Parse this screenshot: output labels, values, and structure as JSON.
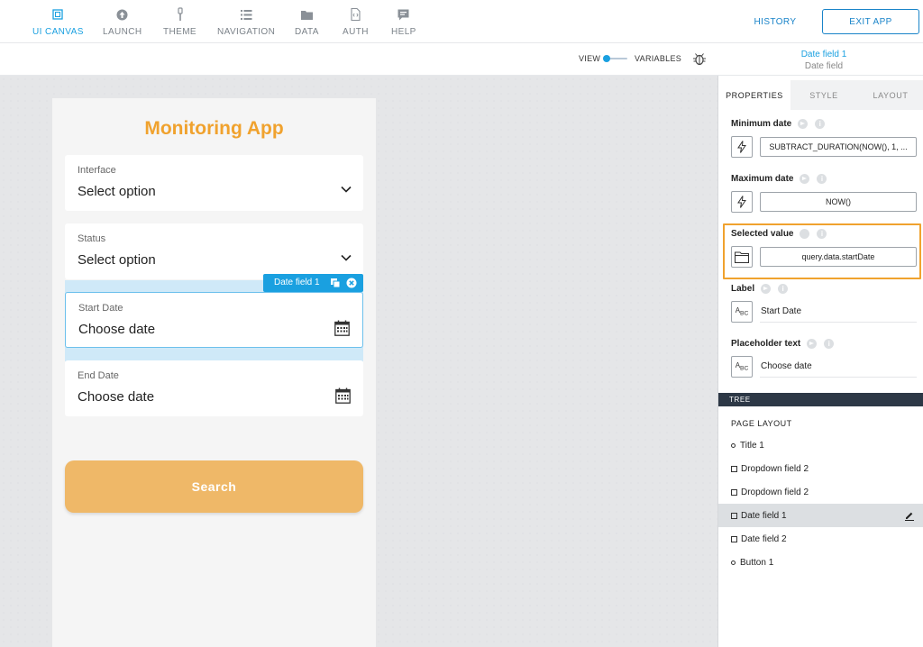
{
  "topnav": {
    "items": [
      {
        "label": "UI CANVAS",
        "icon": "canvas-icon",
        "active": true
      },
      {
        "label": "LAUNCH",
        "icon": "launch-icon"
      },
      {
        "label": "THEME",
        "icon": "theme-icon"
      },
      {
        "label": "NAVIGATION",
        "icon": "navigation-icon"
      },
      {
        "label": "DATA",
        "icon": "folder-icon"
      },
      {
        "label": "AUTH",
        "icon": "auth-icon"
      },
      {
        "label": "HELP",
        "icon": "help-icon"
      }
    ],
    "history_label": "HISTORY",
    "exit_label": "EXIT APP"
  },
  "subbar": {
    "view_label": "VIEW",
    "variables_label": "VARIABLES",
    "selected_title": "Date field 1",
    "selected_subtitle": "Date field"
  },
  "app": {
    "title": "Monitoring App",
    "fields": [
      {
        "label": "Interface",
        "value": "Select option",
        "kind": "dropdown"
      },
      {
        "label": "Status",
        "value": "Select option",
        "kind": "dropdown"
      },
      {
        "label": "Start Date",
        "value": "Choose date",
        "kind": "date"
      },
      {
        "label": "End Date",
        "value": "Choose date",
        "kind": "date"
      }
    ],
    "selection_tag": "Date field 1",
    "search_label": "Search"
  },
  "panel": {
    "tabs": [
      "PROPERTIES",
      "STYLE",
      "LAYOUT"
    ],
    "properties": {
      "min_date": {
        "title": "Minimum date",
        "value": "SUBTRACT_DURATION(NOW(), 1, ..."
      },
      "max_date": {
        "title": "Maximum date",
        "value": "NOW()"
      },
      "selected_value": {
        "title": "Selected value",
        "value": "query.data.startDate"
      },
      "label": {
        "title": "Label",
        "value": "Start Date"
      },
      "placeholder": {
        "title": "Placeholder text",
        "value": "Choose date"
      }
    },
    "tree": {
      "bar_label": "TREE",
      "heading": "PAGE LAYOUT",
      "items": [
        "Title 1",
        "Dropdown field 2",
        "Dropdown field 2",
        "Date field 1",
        "Date field 2",
        "Button 1"
      ]
    }
  },
  "colors": {
    "accent": "#1aa0e0",
    "brand": "#f0a22e",
    "button": "#efb868",
    "highlight": "#f0a22e"
  }
}
